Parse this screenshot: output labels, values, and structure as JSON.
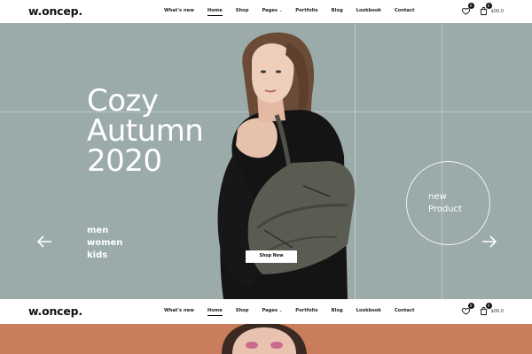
{
  "header": {
    "logo": "w.oncep.",
    "nav": [
      {
        "label": "What's new",
        "active": false
      },
      {
        "label": "Home",
        "active": true
      },
      {
        "label": "Shop",
        "active": false
      },
      {
        "label": "Pages",
        "active": false,
        "dropdown": true
      },
      {
        "label": "Portfolio",
        "active": false
      },
      {
        "label": "Blog",
        "active": false
      },
      {
        "label": "Lookbook",
        "active": false
      },
      {
        "label": "Contact",
        "active": false
      }
    ],
    "wishlist_count": "0",
    "cart_count": "0",
    "cart_total": "$00.0",
    "icons": {
      "wishlist": "heart-icon",
      "cart": "bag-icon"
    }
  },
  "hero": {
    "headline": [
      "Cozy",
      "Autumn",
      "2020"
    ],
    "categories": [
      "men",
      "women",
      "kids"
    ],
    "cta_circle": [
      "new",
      "Product"
    ],
    "shop_button": "Shop Now",
    "colors": {
      "background": "#9aabaa",
      "text": "#ffffff",
      "next_section": "#c97d5d"
    }
  }
}
